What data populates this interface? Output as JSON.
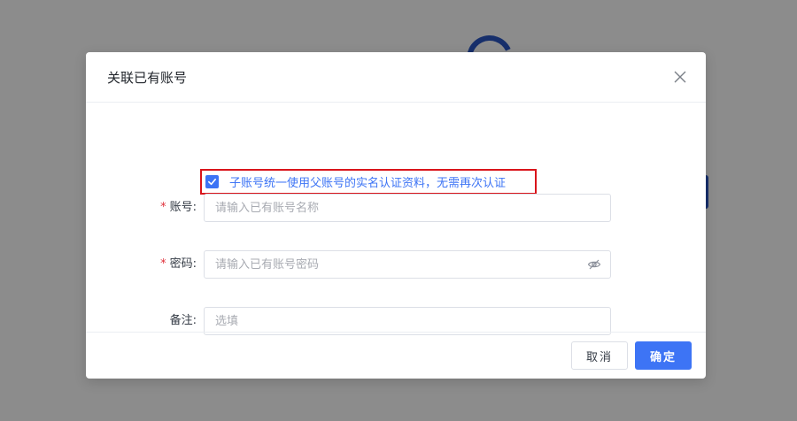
{
  "dialog": {
    "title": "关联已有账号",
    "notice": {
      "checked": true,
      "text": "子账号统一使用父账号的实名认证资料，无需再次认证"
    },
    "fields": {
      "account": {
        "label": "账号:",
        "required": true,
        "placeholder": "请输入已有账号名称",
        "value": ""
      },
      "password": {
        "label": "密码:",
        "required": true,
        "placeholder": "请输入已有账号密码",
        "value": ""
      },
      "remark": {
        "label": "备注:",
        "required": false,
        "placeholder": "选填",
        "value": ""
      }
    },
    "footer": {
      "cancel_label": "取消",
      "ok_label": "确定"
    }
  },
  "icons": {
    "close": "close-icon",
    "checkbox": "check-icon",
    "password_toggle": "eye-slash-icon"
  },
  "colors": {
    "primary": "#3d74f5",
    "highlight_border": "#d9141b",
    "required": "#e0303a"
  }
}
